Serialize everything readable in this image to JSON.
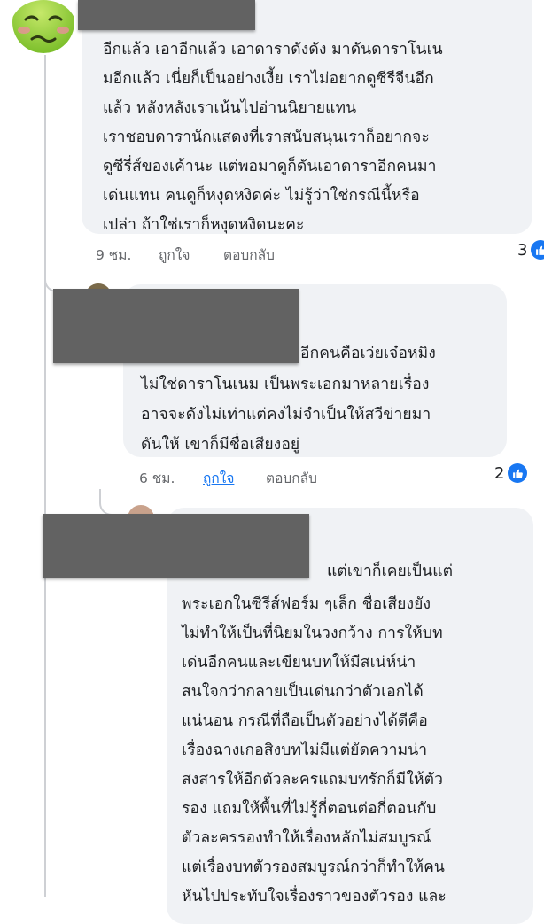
{
  "comment1": {
    "lines": [
      "อีกแล้ว เอาอีกแล้ว เอาดาราดังดัง มาดันดาราโนเน",
      "มอีกแล้ว เนี่ยก็เป็นอย่างเงี้ย เราไม่อยากดูซีรีจีนอีก",
      "แล้ว หลังหลังเราเน้นไปอ่านนิยายแทน",
      " เราชอบดารานักแสดงที่เราสนับสนุนเราก็อยากจะ",
      "ดูซีรี่ส์ของเค้านะ แต่พอมาดูก็ดันเอาดาราอีกคนมา",
      "เด่นแทน คนดูก็หงุดหงิดค่ะ ไม่รู้ว่าใช่กรณีนี้หรือ",
      "เปล่า ถ้าใช่เราก็หงุดหงิดนะคะ"
    ],
    "time": "9 ชม.",
    "like_label": "ถูกใจ",
    "reply_label": "ตอบกลับ",
    "reaction_count": "3"
  },
  "comment2": {
    "lines": [
      "อีกคนคือเว่ยเจ๋อหมิง",
      "ไม่ใช่ดาราโนเนม เป็นพระเอกมาหลายเรื่อง",
      "อาจจะดังไม่เท่าแต่คงไม่จำเป็นให้สวีข่ายมา",
      "ดันให้ เขาก็มีชื่อเสียงอยู่"
    ],
    "time": "6 ชม.",
    "like_label": "ถูกใจ",
    "reply_label": "ตอบกลับ",
    "reaction_count": "2"
  },
  "comment3": {
    "lines": [
      "แต่เขาก็เคยเป็นแต่",
      "พระเอกในซีรีส์ฟอร์ม ๆเล็ก   ชื่อเสียงยัง",
      "ไม่ทำให้เป็นที่นิยมในวงกว้าง  การให้บท",
      "เด่นอีกคนและเขียนบทให้มีสเน่ห์น่า",
      "สนใจกว่ากลายเป็นเด่นกว่าตัวเอกได้",
      "แน่นอน  กรณีที่ถือเป็นตัวอย่างได้ดีคือ",
      "เรื่องฉางเกอสิงบทไม่มีแต่ยัดความน่า",
      "สงสารให้อีกตัวละครแถมบทรักก็มีให้ตัว",
      "รอง   แถมให้พื้นที่ไม่รู้กี่ตอนต่อกี่ตอนกับ",
      "ตัวละครรองทำให้เรื่องหลักไม่สมบูรณ์",
      "แต่เรื่องบทตัวรองสมบูรณ์กว่าก็ทำให้คน",
      "หันไปประทับใจเรื่องราวของตัวรอง  และ"
    ]
  },
  "colors": {
    "bubble": "#f0f2f5",
    "like_blue": "#1877f2",
    "redaction": "#626262"
  },
  "icons": [
    "sick-face-emoji-icon",
    "like-thumb-icon"
  ]
}
